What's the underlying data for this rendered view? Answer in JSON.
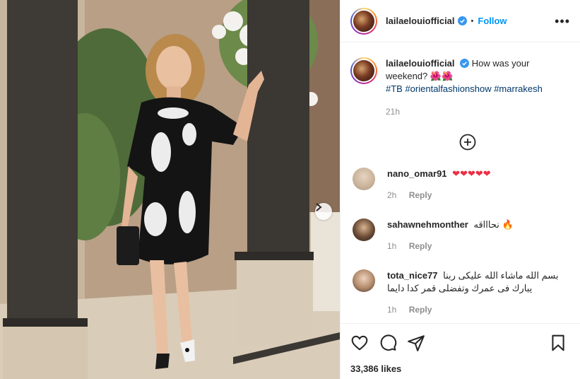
{
  "post": {
    "username": "lailaelouiofficial",
    "follow_label": "Follow",
    "separator": "•",
    "more_label": "•••"
  },
  "caption": {
    "username": "lailaelouiofficial",
    "text": "How was your weekend? 🌺🌺",
    "hashtags": "#TB #orientalfashionshow #marrakesh",
    "time": "21h"
  },
  "comments": [
    {
      "username": "nano_omar91",
      "text": "❤❤❤❤❤",
      "time": "2h",
      "reply": "Reply"
    },
    {
      "username": "sahawnehmonther",
      "text": "نحاااقه 🔥",
      "time": "1h",
      "reply": "Reply"
    },
    {
      "username": "tota_nice77",
      "text": "بسم الله ماشاء الله عليكى ربنا يبارك فى عمرك وتفضلى قمر كدا دايما",
      "time": "1h",
      "reply": "Reply"
    }
  ],
  "likes": "33,386 likes",
  "icons": {
    "verified": "verified-badge-icon",
    "like": "heart-icon",
    "comment": "comment-icon",
    "share": "share-icon",
    "save": "bookmark-icon",
    "add_comment": "plus-circle-icon",
    "next": "chevron-right-icon"
  },
  "colors": {
    "link": "#0095f6",
    "hashtag": "#00376b",
    "meta": "#8e8e8e",
    "heart": "#ed2f45"
  }
}
